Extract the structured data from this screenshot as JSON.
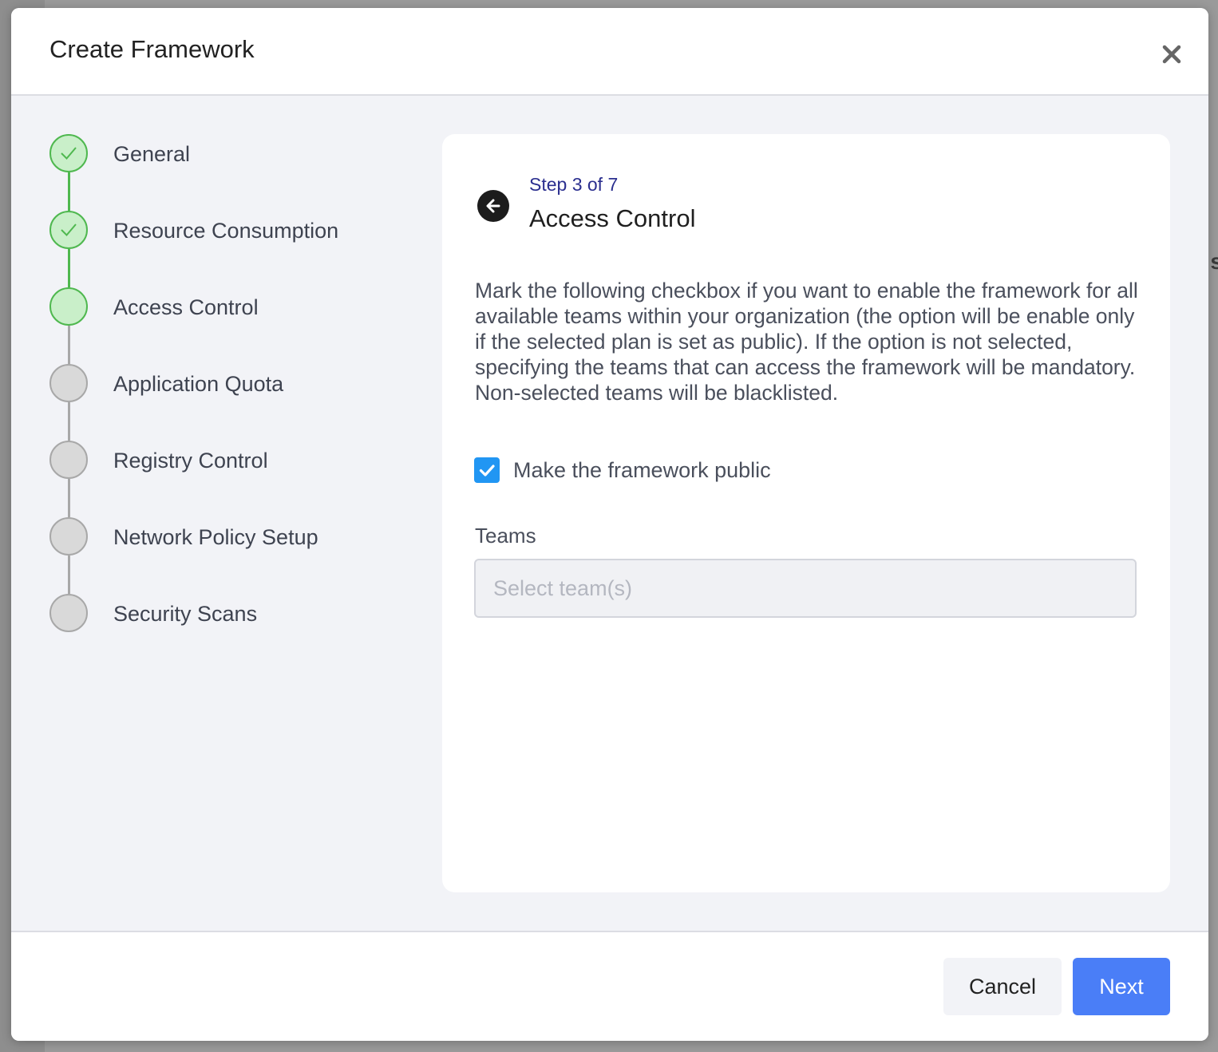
{
  "modal": {
    "title": "Create Framework"
  },
  "stepper": {
    "steps": [
      {
        "label": "General",
        "state": "done"
      },
      {
        "label": "Resource Consumption",
        "state": "done"
      },
      {
        "label": "Access Control",
        "state": "current"
      },
      {
        "label": "Application Quota",
        "state": "pending"
      },
      {
        "label": "Registry Control",
        "state": "pending"
      },
      {
        "label": "Network Policy Setup",
        "state": "pending"
      },
      {
        "label": "Security Scans",
        "state": "pending"
      }
    ]
  },
  "content": {
    "step_counter": "Step 3 of 7",
    "title": "Access Control",
    "description": "Mark the following checkbox if you want to enable the framework for all available teams within your organization (the option will be enable only if the selected plan is set as public). If the option is not selected, specifying the teams that can access the framework will be mandatory. Non-selected teams will be blacklisted.",
    "public_checkbox": {
      "label": "Make the framework public",
      "checked": true
    },
    "teams": {
      "label": "Teams",
      "placeholder": "Select team(s)"
    }
  },
  "footer": {
    "cancel_label": "Cancel",
    "next_label": "Next"
  },
  "background": {
    "partial_text": "s"
  },
  "colors": {
    "accent": "#4a7ef7",
    "checkbox": "#2196f3",
    "step_done": "#4fb84f",
    "step_pending": "#d9d9d9",
    "step_counter": "#2b2f8f"
  }
}
